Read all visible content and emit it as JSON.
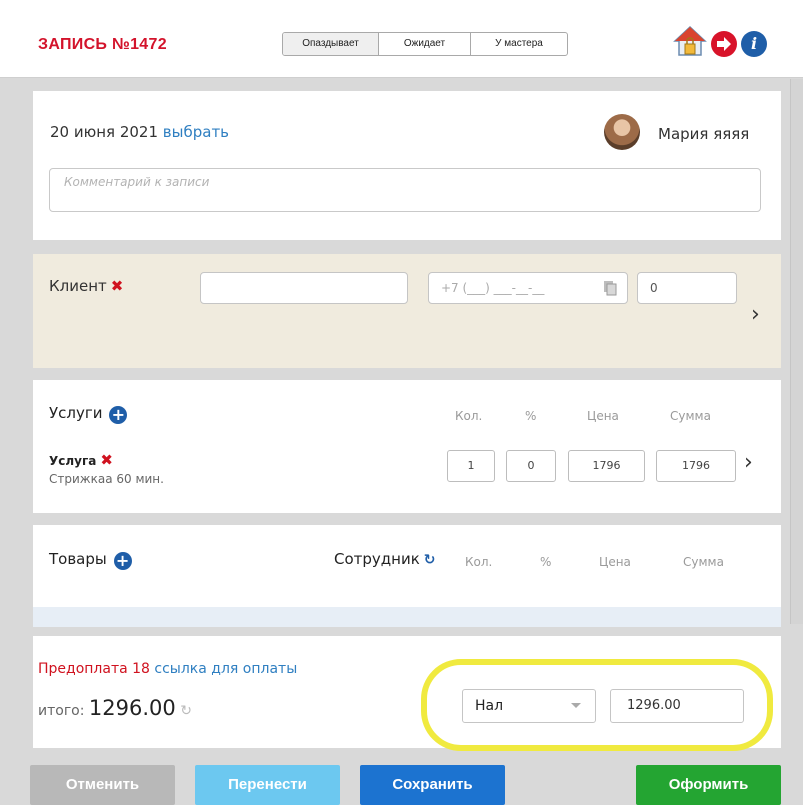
{
  "header": {
    "title": "ЗАПИСЬ №1472",
    "status_tabs": [
      {
        "label": "Опаздывает",
        "active": true
      },
      {
        "label": "Ожидает",
        "active": false
      },
      {
        "label": "У мастера",
        "active": false
      }
    ],
    "icons": [
      "home-lock-icon",
      "red-arrow-icon",
      "info-icon"
    ],
    "info_glyph": "i"
  },
  "appointment": {
    "date": "20 июня 2021",
    "date_link": "выбрать",
    "master_name": "Мария яяяя",
    "comment_placeholder": "Комментарий к записи"
  },
  "client": {
    "label": "Клиент",
    "remove_glyph": "✖",
    "name_value": "",
    "phone_placeholder": "+7 (___) ___-__-__",
    "bonus_value": "0",
    "expand_glyph": "›"
  },
  "services": {
    "title": "Услуги",
    "add_glyph": "+",
    "columns": [
      "Кол.",
      "%",
      "Цена",
      "Сумма"
    ],
    "items": [
      {
        "name": "Услуга",
        "sub": "Стрижкаа 60 мин.",
        "qty": "1",
        "discount": "0",
        "price": "1796",
        "sum": "1796"
      }
    ],
    "expand_glyph": "›"
  },
  "goods": {
    "title": "Товары",
    "add_glyph": "+",
    "employee_label": "Сотрудник",
    "employee_refresh_glyph": "↻",
    "columns": [
      "Кол.",
      "%",
      "Цена",
      "Сумма"
    ]
  },
  "payment": {
    "prepay_text": "Предоплата 18",
    "prepay_link": "ссылка для оплаты",
    "total_label": "итого:",
    "total_value": "1296.00",
    "total_refresh_glyph": "↻",
    "method": "Нал",
    "amount": "1296.00"
  },
  "buttons": {
    "cancel": "Отменить",
    "move": "Перенести",
    "save": "Сохранить",
    "submit": "Оформить"
  },
  "colors": {
    "accent_red": "#d3132b",
    "link_blue": "#2f7fc1",
    "save_blue": "#1c73d0",
    "submit_green": "#24a532",
    "highlight_yellow": "#f0ea3f",
    "client_bg": "#f0ebde"
  }
}
